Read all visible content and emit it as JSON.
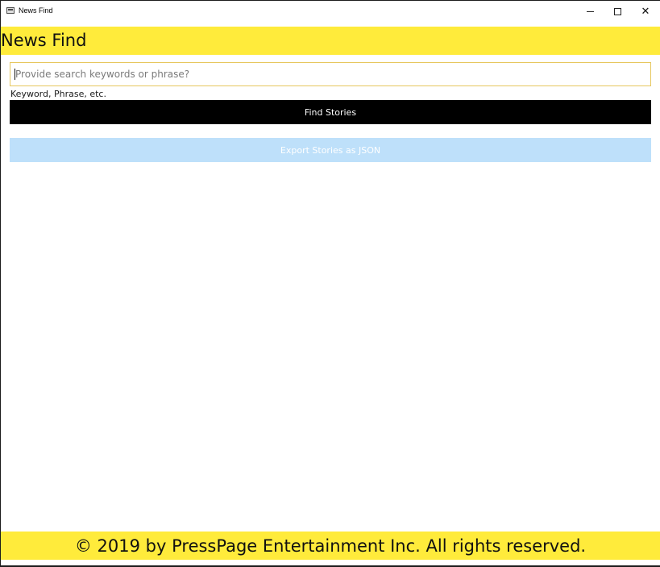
{
  "window": {
    "title": "News Find",
    "controls": {
      "minimize_icon": "minimize-icon",
      "maximize_icon": "maximize-icon",
      "close_icon": "close-icon"
    }
  },
  "header": {
    "title": "News Find",
    "background": "#ffeb3b"
  },
  "search": {
    "value": "",
    "placeholder": "Provide search keywords or phrase?",
    "hint": "Keyword, Phrase, etc."
  },
  "actions": {
    "find_label": "Find Stories",
    "export_label": "Export Stories as JSON",
    "export_enabled": false
  },
  "footer": {
    "text": "© 2019 by PressPage Entertainment Inc. All rights reserved.",
    "background": "#ffeb3b"
  },
  "colors": {
    "accent": "#ffeb3b",
    "primary_button": "#000000",
    "disabled_button": "#bee0fa",
    "input_border": "#e7c75e"
  }
}
